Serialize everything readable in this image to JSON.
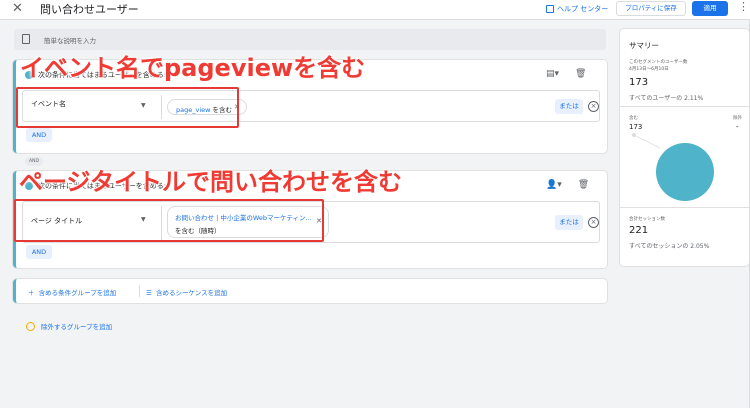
{
  "header": {
    "close_icon": "close-icon",
    "title": "問い合わせユーザー",
    "help_label": "ヘルプ センター",
    "save_label": "プロパティに保存",
    "apply_label": "適用"
  },
  "description": {
    "placeholder": "簡単な説明を入力"
  },
  "groups": [
    {
      "header": "次の条件に当てはまるユーザーを含める:",
      "dimension": "イベント名",
      "chip_value": "page_view",
      "chip_op": "を含む",
      "or_label": "または",
      "and_label": "AND"
    },
    {
      "header": "次の条件に当てはまるユーザーを含める:",
      "dimension": "ページ タイトル",
      "chip_value": "お問い合わせ | 中小企業のWebマーケティン...",
      "chip_op": "を含む（随時）",
      "or_label": "または",
      "and_label": "AND"
    }
  ],
  "and_separator": "AND",
  "add_group_label": "含める条件グループを追加",
  "add_sequence_label": "含めるシーケンスを追加",
  "exclude_label": "除外するグループを追加",
  "summary": {
    "title": "サマリー",
    "users_label": "このセグメントのユーザー数",
    "date_range": "4月13日～6月10日",
    "users_value": "173",
    "users_pct": "すべてのユーザーの 2.11%",
    "include_label": "含む",
    "exclude_label": "除外",
    "include_value": "173",
    "exclude_value": "-",
    "sessions_label": "合計セッション数",
    "sessions_value": "221",
    "sessions_pct": "すべてのセッションの 2.05%",
    "pie_color": "#4fb3c9"
  },
  "annotations": {
    "top": "イベント名でpageviewを含む",
    "bottom": "ページタイトルで問い合わせを含む",
    "color": "#ef3b33"
  }
}
